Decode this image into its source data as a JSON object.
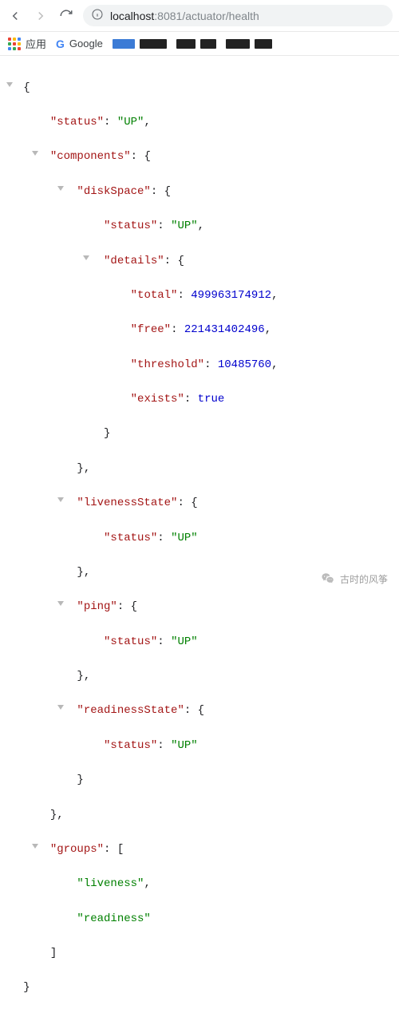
{
  "browser": {
    "url_host": "localhost",
    "url_port": ":8081",
    "url_path": "/actuator/health"
  },
  "bookmarks": {
    "apps_label": "应用",
    "google_label": "Google"
  },
  "json": {
    "k_status": "\"status\"",
    "v_up": "\"UP\"",
    "k_components": "\"components\"",
    "k_diskSpace": "\"diskSpace\"",
    "k_details": "\"details\"",
    "k_total": "\"total\"",
    "v_total": "499963174912",
    "k_free": "\"free\"",
    "v_free": "221431402496",
    "k_threshold": "\"threshold\"",
    "v_threshold": "10485760",
    "k_exists": "\"exists\"",
    "v_exists": "true",
    "k_liveness": "\"livenessState\"",
    "k_ping": "\"ping\"",
    "k_readiness": "\"readinessState\"",
    "k_groups": "\"groups\"",
    "v_liveness": "\"liveness\"",
    "v_readiness": "\"readiness\""
  },
  "footer": {
    "label": "古时的风筝"
  }
}
